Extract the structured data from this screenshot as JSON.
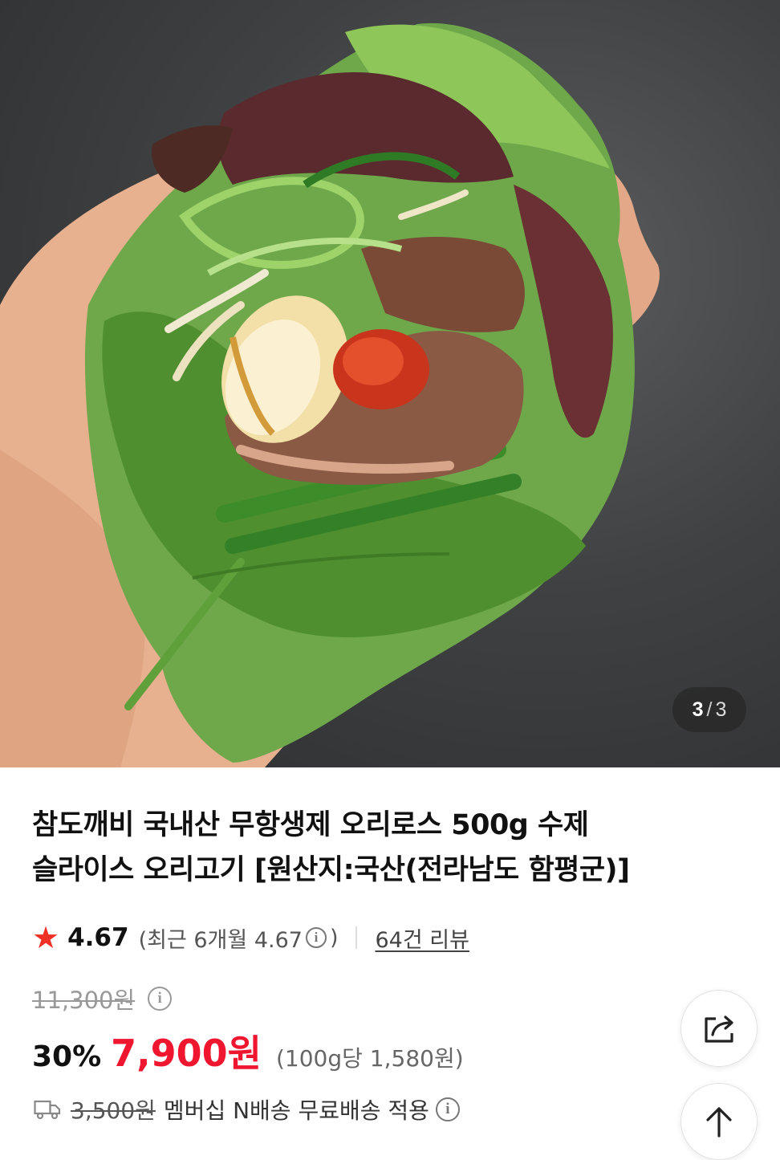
{
  "hero": {
    "image_description": "",
    "indicator": {
      "current": "3",
      "separator": "/",
      "total": "3"
    }
  },
  "product": {
    "title_line1": "참도깨비 국내산 무항생제 오리로스 500g 수제",
    "title_line2": "슬라이스 오리고기 [원산지:국산(전라남도 함평군)]"
  },
  "rating": {
    "star": "★",
    "value": "4.67",
    "recent_prefix": "(최근 6개월 4.67",
    "recent_suffix": ")",
    "reviews_link": "64건 리뷰"
  },
  "price": {
    "original": "11,300원",
    "discount": "30%",
    "sale": "7,900원",
    "unit": "(100g당 1,580원)"
  },
  "shipping": {
    "old_fee": "3,500원",
    "text": "멤버십 N배송 무료배송 적용"
  },
  "icons": {
    "info": "i",
    "truck": "truck-icon",
    "share": "share-icon",
    "top": "arrow-up-icon"
  },
  "colors": {
    "sale_red": "#f0162f",
    "star_red": "#ee3124"
  }
}
